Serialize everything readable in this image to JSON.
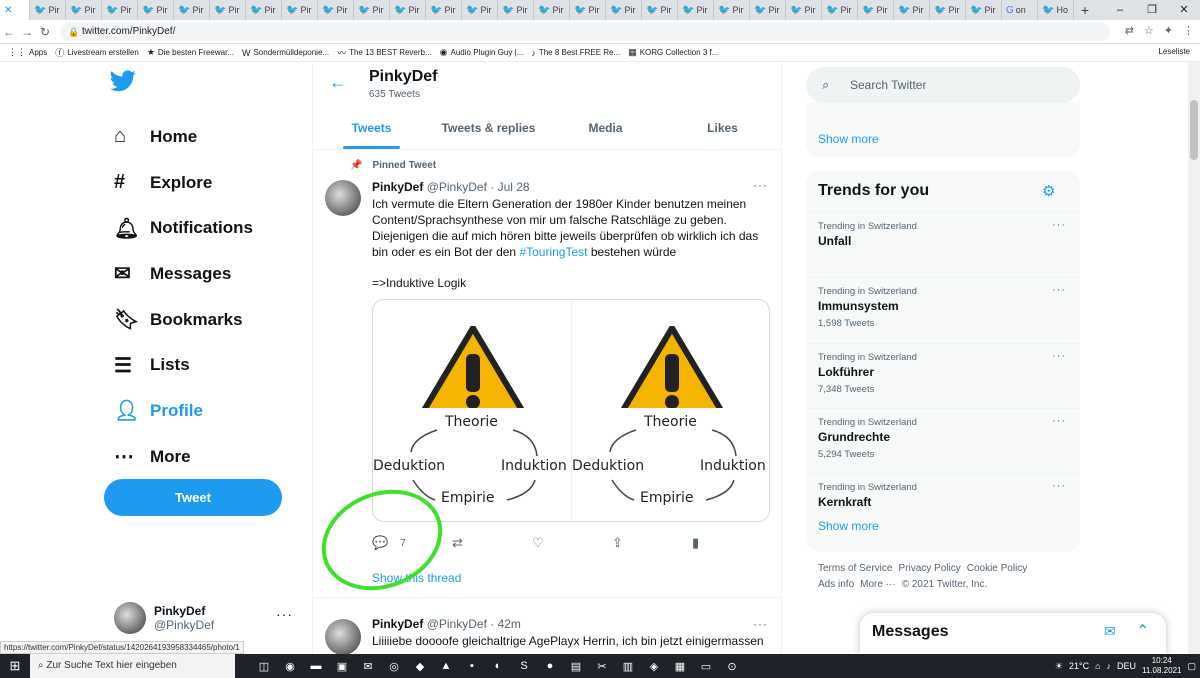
{
  "browser": {
    "tab_labels": [
      "Pir",
      "Pir",
      "Pir",
      "Pir",
      "Pir",
      "Pir",
      "Pir",
      "Pir",
      "Pir",
      "Pir",
      "Pir",
      "Pir",
      "Pir",
      "Pir",
      "Pir",
      "Pir",
      "Pir",
      "Pir",
      "Pir",
      "Pir",
      "Pir",
      "Pir",
      "Pir",
      "Pir",
      "Pir",
      "Pir",
      "Pir",
      "on",
      "Ho"
    ],
    "url": "twitter.com/PinkyDef/",
    "bookmarks": [
      "Apps",
      "Livestream erstellen",
      "Die besten Freewar...",
      "Sondermülldeponie...",
      "The 13 BEST Reverb...",
      "Audio Plugin Guy |...",
      "The 8 Best FREE Re...",
      "KORG Collection 3 f..."
    ],
    "reading_list": "Leseliste",
    "status_url": "https://twitter.com/PinkyDef/status/1420264193958334465/photo/1"
  },
  "nav": {
    "items": [
      {
        "label": "Home",
        "icon": "home-icon"
      },
      {
        "label": "Explore",
        "icon": "hashtag-icon"
      },
      {
        "label": "Notifications",
        "icon": "bell-icon"
      },
      {
        "label": "Messages",
        "icon": "mail-icon"
      },
      {
        "label": "Bookmarks",
        "icon": "bookmark-icon"
      },
      {
        "label": "Lists",
        "icon": "list-icon"
      },
      {
        "label": "Profile",
        "icon": "person-icon"
      },
      {
        "label": "More",
        "icon": "more-icon"
      }
    ],
    "tweet_button": "Tweet",
    "account": {
      "name": "PinkyDef",
      "handle": "@PinkyDef"
    }
  },
  "profile": {
    "name": "PinkyDef",
    "tweet_count": "635 Tweets",
    "tabs": [
      "Tweets",
      "Tweets & replies",
      "Media",
      "Likes"
    ]
  },
  "pinned_tweet": {
    "pinned_label": "Pinned Tweet",
    "author": "PinkyDef",
    "handle_date": "@PinkyDef · Jul 28",
    "text_before": "Ich vermute die Eltern Generation der 1980er Kinder benutzen meinen Content/Sprachsynthese von mir um falsche Ratschläge zu geben. Diejenigen die auf mich hören bitte jeweils überprüfen ob wirklich ich das bin oder es ein Bot der den ",
    "hashtag": "#TouringTest",
    "text_after": " bestehen würde",
    "text_line2": "=>Induktive Logik",
    "image": {
      "top": "Theorie",
      "left": "Deduktion",
      "right": "Induktion",
      "bottom": "Empirie"
    },
    "reply_count": "7",
    "show_thread": "Show this thread"
  },
  "second_tweet": {
    "author": "PinkyDef",
    "handle_date": "@PinkyDef · 42m",
    "text": "Liiiiiebe doooofe gleichaltrige AgePlayx Herrin, ich bin jetzt einigermassen"
  },
  "sidebar": {
    "search_placeholder": "Search Twitter",
    "show_more": "Show more",
    "trends_title": "Trends for you",
    "trends": [
      {
        "context": "Trending in Switzerland",
        "topic": "Unfall",
        "count": ""
      },
      {
        "context": "Trending in Switzerland",
        "topic": "Immunsystem",
        "count": "1,598 Tweets"
      },
      {
        "context": "Trending in Switzerland",
        "topic": "Lokführer",
        "count": "7,348 Tweets"
      },
      {
        "context": "Trending in Switzerland",
        "topic": "Grundrechte",
        "count": "5,294 Tweets"
      },
      {
        "context": "Trending in Switzerland",
        "topic": "Kernkraft",
        "count": ""
      }
    ],
    "trends_show_more": "Show more",
    "footer": [
      "Terms of Service",
      "Privacy Policy",
      "Cookie Policy",
      "Ads info",
      "More ···",
      "© 2021 Twitter, Inc."
    ],
    "messages_title": "Messages"
  },
  "taskbar": {
    "search_placeholder": "Zur Suche Text hier eingeben",
    "weather": "21°C",
    "language": "DEU",
    "time": "10:24",
    "date": "11.08.2021"
  },
  "colors": {
    "twitter_blue": "#1d9bf0",
    "highlight_green": "#3ee02a"
  }
}
